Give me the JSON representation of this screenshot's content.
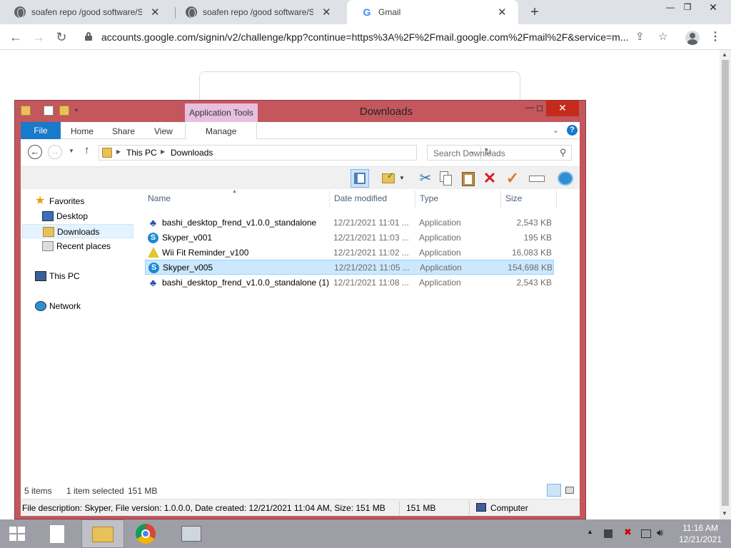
{
  "browser": {
    "tabs": [
      {
        "title": "soafen repo /good software/Secu",
        "icon": "globe-icon"
      },
      {
        "title": "soafen repo /good software/Secu",
        "icon": "globe-icon"
      },
      {
        "title": "Gmail",
        "icon": "google-icon",
        "active": true
      }
    ],
    "new_tab_label": "+",
    "close_glyph": "✕",
    "url": "accounts.google.com/signin/v2/challenge/kpp?continue=https%3A%2F%2Fmail.google.com%2Fmail%2F&service=m...",
    "window_controls": {
      "minimize": "—",
      "restore": "❐",
      "close": "✕"
    }
  },
  "explorer": {
    "title": "Downloads",
    "context_tab": "Application Tools",
    "ribbon_tabs": {
      "file": "File",
      "home": "Home",
      "share": "Share",
      "view": "View",
      "manage": "Manage"
    },
    "breadcrumb": [
      "This PC",
      "Downloads"
    ],
    "search_placeholder": "Search Downloads",
    "nav": {
      "favorites": "Favorites",
      "desktop": "Desktop",
      "downloads": "Downloads",
      "recent": "Recent places",
      "this_pc": "This PC",
      "network": "Network"
    },
    "columns": {
      "name": "Name",
      "date": "Date modified",
      "type": "Type",
      "size": "Size"
    },
    "files": [
      {
        "name": "bashi_desktop_frend_v1.0.0_standalone",
        "date": "12/21/2021 11:01 ...",
        "type": "Application",
        "size": "2,543 KB",
        "icon": "bashi-app-icon"
      },
      {
        "name": "Skyper_v001",
        "date": "12/21/2021 11:03 ...",
        "type": "Application",
        "size": "195 KB",
        "icon": "skype-icon"
      },
      {
        "name": "Wii Fit Reminder_v100",
        "date": "12/21/2021 11:02 ...",
        "type": "Application",
        "size": "16,083 KB",
        "icon": "warning-app-icon"
      },
      {
        "name": "Skyper_v005",
        "date": "12/21/2021 11:05 ...",
        "type": "Application",
        "size": "154,698 KB",
        "icon": "skype-icon",
        "selected": true
      },
      {
        "name": "bashi_desktop_frend_v1.0.0_standalone (1)",
        "date": "12/21/2021 11:08 ...",
        "type": "Application",
        "size": "2,543 KB",
        "icon": "bashi-app-icon"
      }
    ],
    "status": {
      "items": "5 items",
      "selected": "1 item selected",
      "size": "151 MB"
    },
    "details": {
      "description": "File description: Skyper, File version: 1.0.0.0, Date created: 12/21/2021 11:04 AM, Size: 151 MB",
      "size": "151 MB",
      "location": "Computer"
    }
  },
  "taskbar": {
    "time": "11:16 AM",
    "date": "12/21/2021"
  },
  "colors": {
    "explorer_frame": "#c3575d",
    "selection": "#cce8ff",
    "file_tab": "#1979ca",
    "taskbar": "#9e9ea6"
  }
}
